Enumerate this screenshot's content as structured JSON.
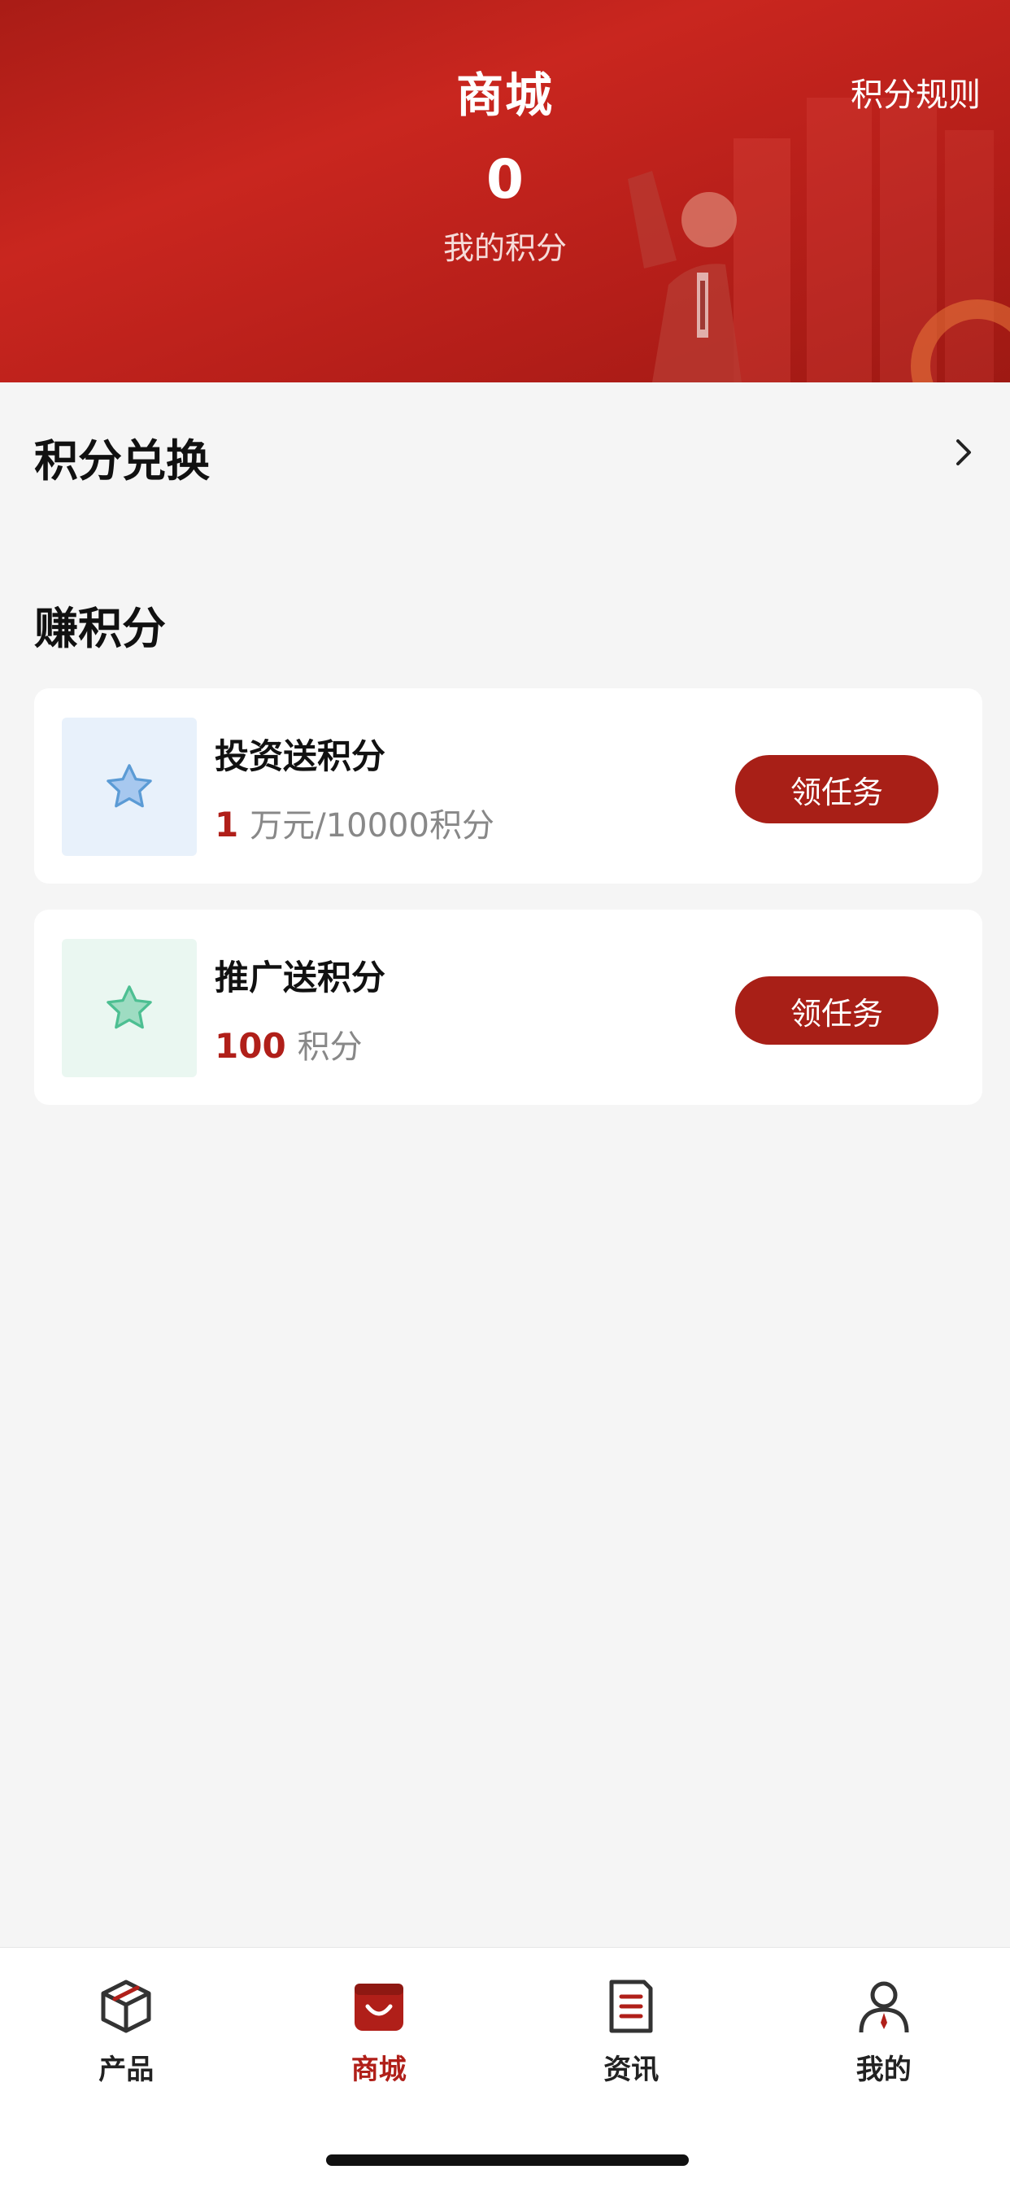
{
  "header": {
    "title": "商城",
    "rules_link": "积分规则",
    "points_value": "0",
    "points_label": "我的积分"
  },
  "exchange": {
    "title": "积分兑换"
  },
  "earn": {
    "title": "赚积分",
    "tasks": [
      {
        "name": "投资送积分",
        "reward_value": "1",
        "reward_unit": "万元/10000积分",
        "button": "领任务",
        "icon": "star-icon",
        "icon_color": "#5b9bd5"
      },
      {
        "name": "推广送积分",
        "reward_value": "100",
        "reward_unit": "积分",
        "button": "领任务",
        "icon": "star-icon",
        "icon_color": "#4dbf92"
      }
    ]
  },
  "tabbar": {
    "items": [
      {
        "label": "产品",
        "icon": "cube-icon"
      },
      {
        "label": "商城",
        "icon": "shop-bag-icon"
      },
      {
        "label": "资讯",
        "icon": "news-icon"
      },
      {
        "label": "我的",
        "icon": "user-icon"
      }
    ],
    "active_index": 1
  },
  "colors": {
    "brand_red": "#b01f19",
    "header_red": "#c9261f",
    "background": "#f5f5f5"
  }
}
